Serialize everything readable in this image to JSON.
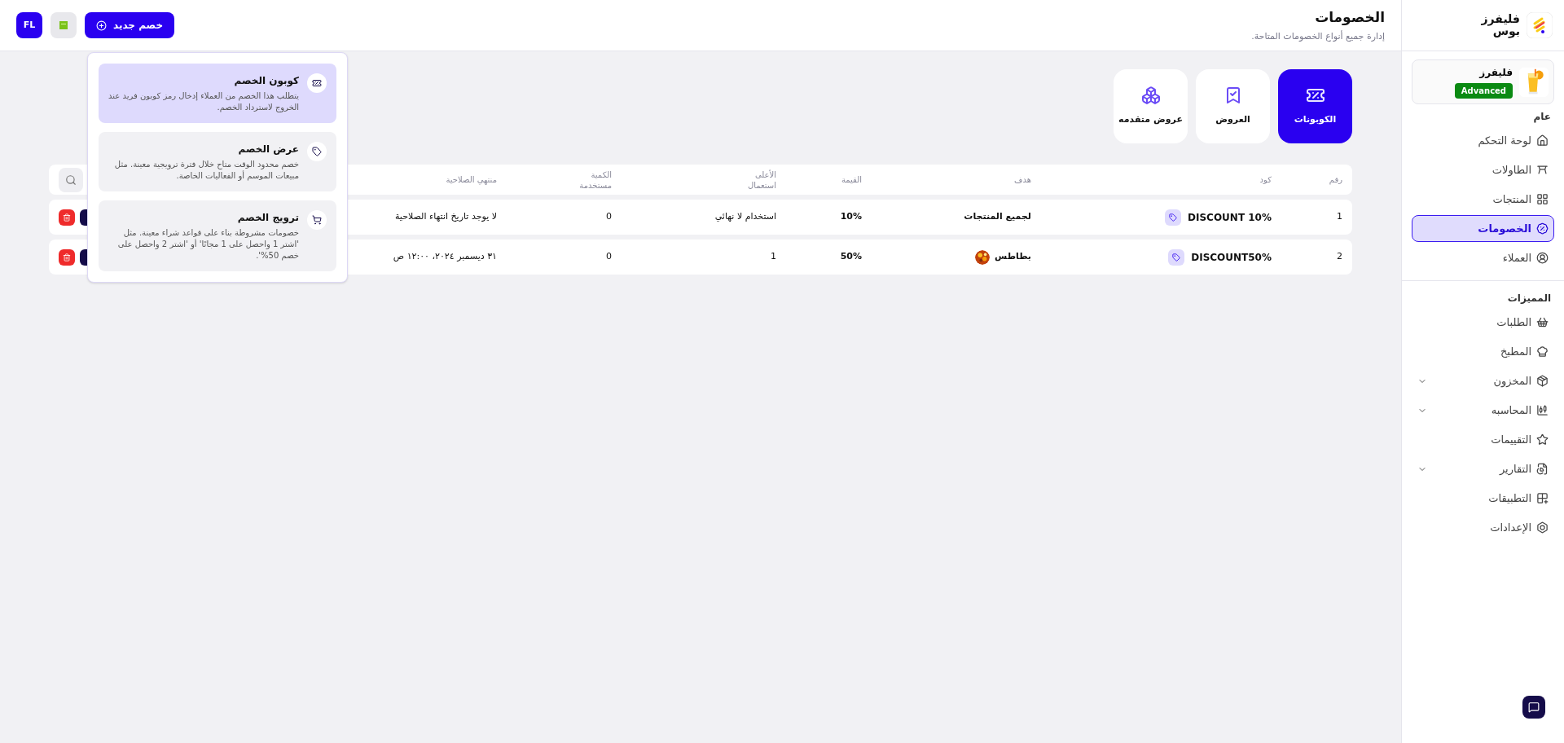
{
  "sidebar": {
    "brand": "فليفرز بوس",
    "store": {
      "name": "فليفرز",
      "plan": "Advanced"
    },
    "sections": [
      {
        "title": "عام",
        "items": [
          {
            "label": "لوحة التحكم",
            "selected": false,
            "has_submenu": false
          },
          {
            "label": "الطاولات",
            "selected": false,
            "has_submenu": false
          },
          {
            "label": "المنتجات",
            "selected": false,
            "has_submenu": false
          },
          {
            "label": "الخصومات",
            "selected": true,
            "has_submenu": false
          },
          {
            "label": "العملاء",
            "selected": false,
            "has_submenu": false
          }
        ]
      },
      {
        "title": "المميزات",
        "items": [
          {
            "label": "الطلبات",
            "selected": false,
            "has_submenu": false
          },
          {
            "label": "المطبخ",
            "selected": false,
            "has_submenu": false
          },
          {
            "label": "المخزون",
            "selected": false,
            "has_submenu": true
          },
          {
            "label": "المحاسبه",
            "selected": false,
            "has_submenu": true
          },
          {
            "label": "التقييمات",
            "selected": false,
            "has_submenu": false
          },
          {
            "label": "التقارير",
            "selected": false,
            "has_submenu": true
          },
          {
            "label": "التطبيقات",
            "selected": false,
            "has_submenu": false
          },
          {
            "label": "الإعدادات",
            "selected": false,
            "has_submenu": false
          }
        ]
      }
    ]
  },
  "header": {
    "title": "الخصومات",
    "subtitle": "إدارة جميع أنواع الخصومات المتاحة.",
    "new_button": "خصم جديد",
    "user_initials": "FL"
  },
  "new_menu": [
    {
      "title": "كوبون الخصم",
      "description": "يتطلب هذا الخصم من العملاء إدخال رمز كوبون فريد عند الخروج لاسترداد الخصم.",
      "selected": true
    },
    {
      "title": "عرض الخصم",
      "description": "خصم محدود الوقت متاح خلال فترة ترويجية معينة. مثل مبيعات الموسم أو الفعاليات الخاصة.",
      "selected": false
    },
    {
      "title": "ترويج الخصم",
      "description": "خصومات مشروطة بناء على قواعد شراء معينة. مثل 'اشتر 1 واحصل على 1 مجانًا' أو 'اشتر 2 واحصل على خصم 50%'.",
      "selected": false
    }
  ],
  "tabs": [
    {
      "label": "الكوبونات",
      "selected": true
    },
    {
      "label": "العروض",
      "selected": false
    },
    {
      "label": "عروض متقدمه",
      "selected": false
    }
  ],
  "table": {
    "columns": [
      "رقم",
      "كود",
      "هدف",
      "القيمة",
      "الأعلى استعمال",
      "الكمية مستخدمة",
      "منتهي الصلاحية"
    ],
    "rows": [
      {
        "number": "1",
        "code": "DISCOUNT 10%",
        "target": {
          "text": "لجميع المنتجات",
          "kind": "all"
        },
        "value": "10%",
        "max_use": "استخدام لا نهائي",
        "used": "0",
        "expiry": "لا يوجد تاريخ انتهاء الصلاحية"
      },
      {
        "number": "2",
        "code": "DISCOUNT50%",
        "target": {
          "text": "بطاطس",
          "kind": "product"
        },
        "value": "50%",
        "max_use": "1",
        "used": "0",
        "expiry": "٣١ ديسمبر ٢٠٢٤، ١٢:٠٠ ص"
      }
    ]
  }
}
